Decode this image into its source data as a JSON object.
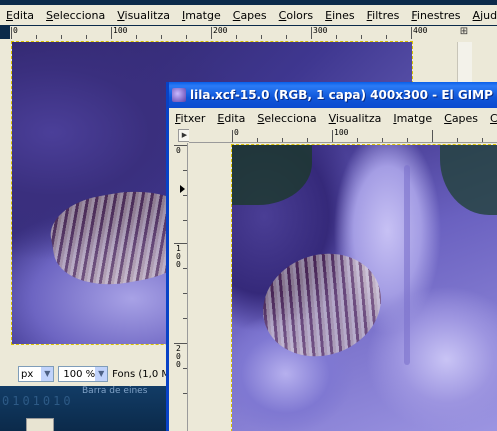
{
  "background_window": {
    "menu": [
      "Edita",
      "Selecciona",
      "Visualitza",
      "Imatge",
      "Capes",
      "Colors",
      "Eines",
      "Filtres",
      "Finestres",
      "Ajuda"
    ],
    "ruler_top_labels": [
      "0",
      "100",
      "200",
      "300",
      "400"
    ],
    "status": {
      "unit": "px",
      "zoom": "100 %",
      "text": "Fons (1,0 M"
    },
    "desktop": {
      "binary": "0101010",
      "caption": "Barra de eines"
    }
  },
  "foreground_window": {
    "title": "lila.xcf-15.0 (RGB, 1 capa) 400x300 - El GIMP",
    "menu": [
      "Fitxer",
      "Edita",
      "Selecciona",
      "Visualitza",
      "Imatge",
      "Capes",
      "Colors"
    ],
    "ruler_top_labels": [
      "0",
      "100"
    ],
    "ruler_left_labels": [
      "0",
      "100",
      "200"
    ]
  },
  "colors": {
    "titlebar": "#0b4ad0",
    "window_chrome": "#ece9d8",
    "selection_border": "#d8c000"
  }
}
